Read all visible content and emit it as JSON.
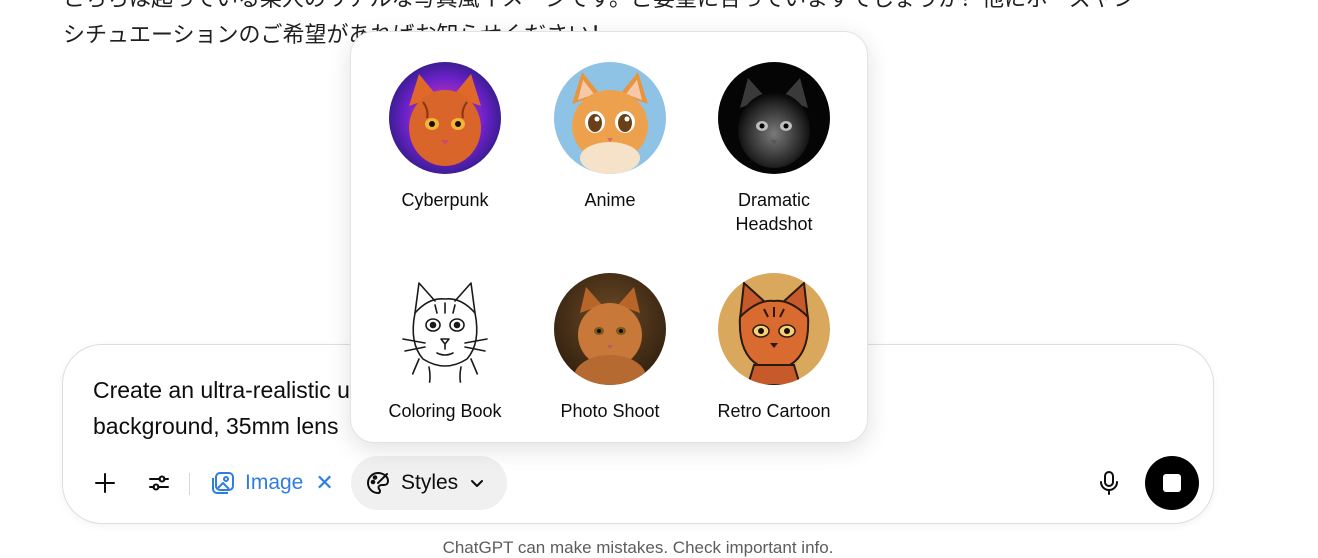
{
  "conversation": {
    "message_line_1": "こちらは起っている某人のリアルな写真風イメージです。ご要望に合っていますでしょうか？他にポーズやシ",
    "message_line_2": "シチュエーションのご希望があればお知らせください！"
  },
  "composer": {
    "prompt_line_1": "Create an ultra-realistic                                                                                                 up, black shadow",
    "prompt_line_2": "background, 35mm lens",
    "plus_icon": "plus-icon",
    "tools_icon": "sliders-icon",
    "image_chip_label": "Image",
    "image_chip_icon": "image-icon",
    "styles_label": "Styles",
    "styles_icon": "palette-icon",
    "mic_icon": "microphone-icon",
    "stop_icon": "stop-icon",
    "accent_color": "#2f7de1"
  },
  "styles_menu": {
    "options": [
      {
        "label": "Cyberpunk",
        "icon": "cyberpunk-cat-thumbnail"
      },
      {
        "label": "Anime",
        "icon": "anime-cat-thumbnail"
      },
      {
        "label": "Dramatic Headshot",
        "icon": "dramatic-cat-thumbnail"
      },
      {
        "label": "Coloring Book",
        "icon": "coloring-book-cat-thumbnail"
      },
      {
        "label": "Photo Shoot",
        "icon": "photo-cat-thumbnail"
      },
      {
        "label": "Retro Cartoon",
        "icon": "retro-cat-thumbnail"
      }
    ]
  },
  "footer": {
    "disclaimer": "ChatGPT can make mistakes. Check important info."
  }
}
